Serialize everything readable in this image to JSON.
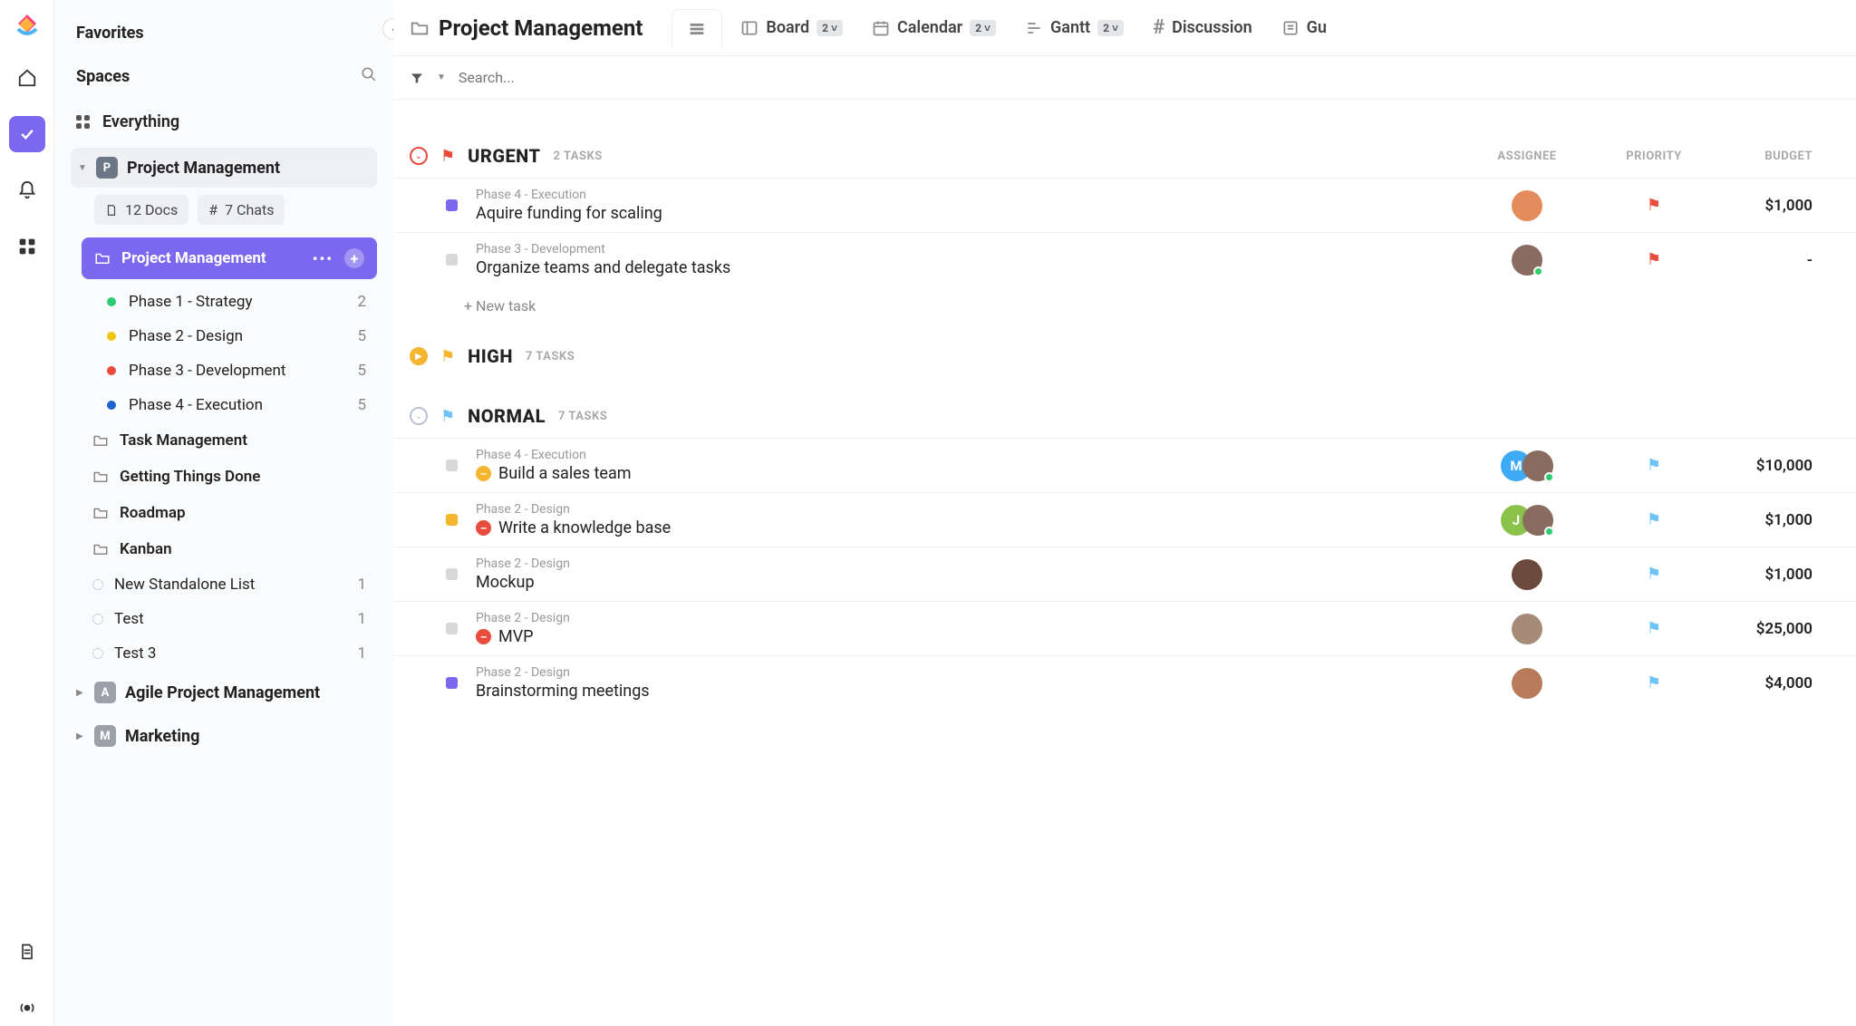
{
  "sidebar": {
    "favorites": "Favorites",
    "spaces": "Spaces",
    "everything": "Everything",
    "space": {
      "badge": "P",
      "name": "Project Management",
      "docs": "12 Docs",
      "chats": "7 Chats"
    },
    "active_folder": "Project Management",
    "phases": [
      {
        "label": "Phase 1 - Strategy",
        "count": "2",
        "color": "#2ecc71"
      },
      {
        "label": "Phase 2 - Design",
        "count": "5",
        "color": "#f1c40f"
      },
      {
        "label": "Phase 3 - Development",
        "count": "5",
        "color": "#e74c3c"
      },
      {
        "label": "Phase 4 - Execution",
        "count": "5",
        "color": "#1e62d0"
      }
    ],
    "folders": [
      "Task Management",
      "Getting Things Done",
      "Roadmap",
      "Kanban"
    ],
    "lists": [
      {
        "label": "New Standalone List",
        "count": "1"
      },
      {
        "label": "Test",
        "count": "1"
      },
      {
        "label": "Test 3",
        "count": "1"
      }
    ],
    "other_spaces": [
      {
        "badge": "A",
        "name": "Agile Project Management",
        "color": "#9aa1ab"
      },
      {
        "badge": "M",
        "name": "Marketing",
        "color": "#9aa1ab"
      }
    ]
  },
  "header": {
    "title": "Project Management",
    "views": [
      {
        "label": "Board",
        "badge": "2"
      },
      {
        "label": "Calendar",
        "badge": "2"
      },
      {
        "label": "Gantt",
        "badge": "2"
      },
      {
        "label": "Discussion",
        "badge": ""
      },
      {
        "label": "Gu",
        "badge": ""
      }
    ]
  },
  "search_placeholder": "Search...",
  "columns": {
    "assignee": "ASSIGNEE",
    "priority": "PRIORITY",
    "budget": "BUDGET"
  },
  "new_task": "+ New task",
  "groups": [
    {
      "id": "urgent",
      "label": "URGENT",
      "count": "2 TASKS",
      "color": "#e74c3c",
      "flag": "#e74c3c",
      "tasks": [
        {
          "phase": "Phase 4 - Execution",
          "title": "Aquire funding for scaling",
          "status": "#7B68EE",
          "budget": "$1,000",
          "priority": "#e74c3c",
          "avatars": [
            {
              "type": "img",
              "bg": "#e38b5a"
            }
          ]
        },
        {
          "phase": "Phase 3 - Development",
          "title": "Organize teams and delegate tasks",
          "status": "#d8d8d8",
          "budget": "-",
          "priority": "#e74c3c",
          "avatars": [
            {
              "type": "img",
              "bg": "#8a6b5f",
              "presence": true
            }
          ]
        }
      ]
    },
    {
      "id": "high",
      "label": "HIGH",
      "count": "7 TASKS",
      "color": "#f5b52e",
      "flag": "#f5b52e",
      "collapsed": true,
      "tasks": []
    },
    {
      "id": "normal",
      "label": "NORMAL",
      "count": "7 TASKS",
      "color": "#b8c4d6",
      "flag": "#6fc3f7",
      "tasks": [
        {
          "phase": "Phase 4 - Execution",
          "title": "Build a sales team",
          "icon": "#f5b52e",
          "status": "#d8d8d8",
          "budget": "$10,000",
          "priority": "#6fc3f7",
          "avatars": [
            {
              "type": "ltr",
              "txt": "M",
              "bg": "#3ea9f5"
            },
            {
              "type": "img",
              "bg": "#8a6b5f",
              "presence": true
            }
          ]
        },
        {
          "phase": "Phase 2 - Design",
          "title": "Write a knowledge base",
          "icon": "#e74c3c",
          "status": "#f5b52e",
          "budget": "$1,000",
          "priority": "#6fc3f7",
          "avatars": [
            {
              "type": "ltr",
              "txt": "J",
              "bg": "#8bc34a"
            },
            {
              "type": "img",
              "bg": "#8a6b5f",
              "presence": true
            }
          ]
        },
        {
          "phase": "Phase 2 - Design",
          "title": "Mockup",
          "status": "#d8d8d8",
          "budget": "$1,000",
          "priority": "#6fc3f7",
          "avatars": [
            {
              "type": "img",
              "bg": "#6b4a3d"
            }
          ]
        },
        {
          "phase": "Phase 2 - Design",
          "title": "MVP",
          "icon": "#e74c3c",
          "status": "#d8d8d8",
          "budget": "$25,000",
          "priority": "#6fc3f7",
          "avatars": [
            {
              "type": "img",
              "bg": "#a58b78"
            }
          ]
        },
        {
          "phase": "Phase 2 - Design",
          "title": "Brainstorming meetings",
          "status": "#7B68EE",
          "budget": "$4,000",
          "priority": "#6fc3f7",
          "avatars": [
            {
              "type": "img",
              "bg": "#b87a5a"
            }
          ]
        }
      ]
    }
  ]
}
